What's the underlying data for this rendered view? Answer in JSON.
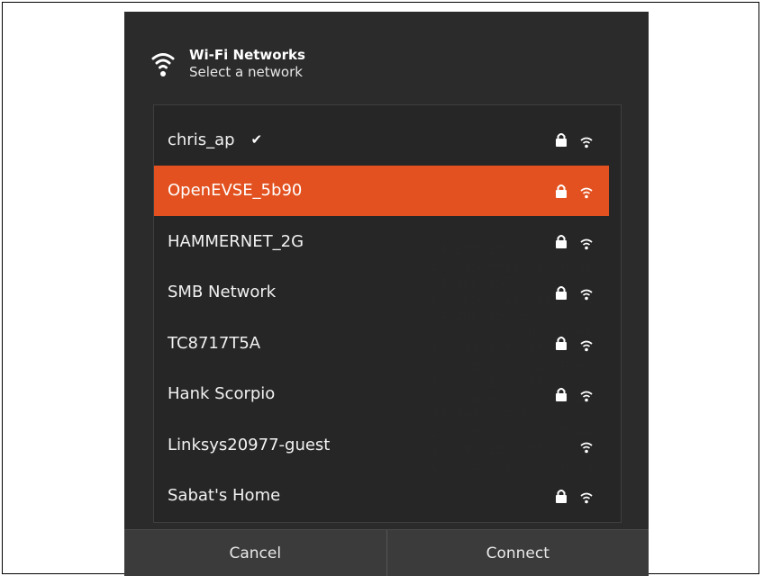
{
  "dialog": {
    "title": "Wi-Fi Networks",
    "subtitle": "Select a network",
    "header_icon": "wifi-icon"
  },
  "networks": [
    {
      "name": "chris_ap",
      "connected": true,
      "secured": true,
      "selected": false
    },
    {
      "name": "OpenEVSE_5b90",
      "connected": false,
      "secured": true,
      "selected": true
    },
    {
      "name": "HAMMERNET_2G",
      "connected": false,
      "secured": true,
      "selected": false
    },
    {
      "name": "SMB Network",
      "connected": false,
      "secured": true,
      "selected": false
    },
    {
      "name": "TC8717T5A",
      "connected": false,
      "secured": true,
      "selected": false
    },
    {
      "name": "Hank Scorpio",
      "connected": false,
      "secured": true,
      "selected": false
    },
    {
      "name": "Linksys20977-guest",
      "connected": false,
      "secured": false,
      "selected": false
    },
    {
      "name": "Sabat's Home",
      "connected": false,
      "secured": true,
      "selected": false
    }
  ],
  "buttons": {
    "cancel": "Cancel",
    "connect": "Connect"
  },
  "colors": {
    "accent": "#e2511f",
    "dialog_bg": "#2b2b2b"
  },
  "icons": {
    "connected": "check-icon",
    "secured": "lock-icon",
    "signal": "wifi-signal-icon"
  }
}
